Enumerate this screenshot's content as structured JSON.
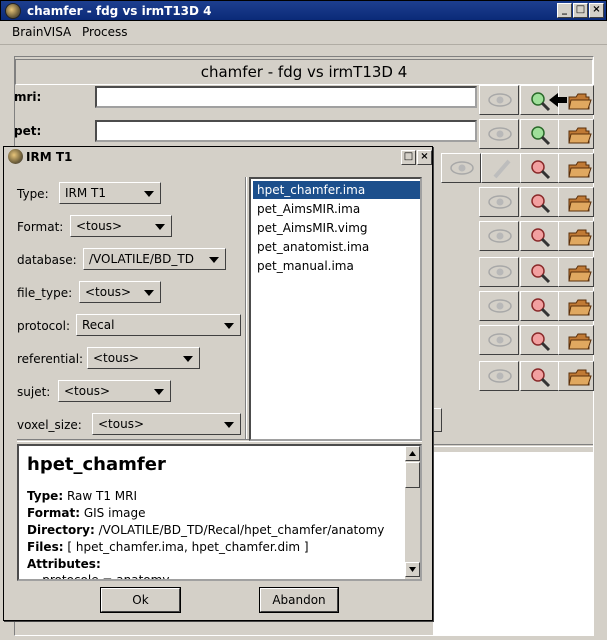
{
  "window": {
    "title": "chamfer - fdg vs irmT13D 4"
  },
  "menu": [
    {
      "label": "BrainVISA",
      "underline": "B"
    },
    {
      "label": "Process",
      "underline": "P"
    }
  ],
  "process": {
    "title": "chamfer - fdg vs irmT13D 4",
    "params": [
      {
        "label": "mri:",
        "value": ""
      },
      {
        "label": "pet:",
        "value": ""
      }
    ]
  },
  "dialog": {
    "title": "IRM T1",
    "fields": [
      {
        "label": "Type:",
        "value": "IRM T1"
      },
      {
        "label": "Format:",
        "value": "<tous>"
      },
      {
        "label": "database:",
        "value": "/VOLATILE/BD_TD"
      },
      {
        "label": "file_type:",
        "value": "<tous>"
      },
      {
        "label": "protocol:",
        "value": "Recal"
      },
      {
        "label": "referential:",
        "value": "<tous>"
      },
      {
        "label": "sujet:",
        "value": "<tous>"
      },
      {
        "label": "voxel_size:",
        "value": "<tous>"
      }
    ],
    "files": [
      "hpet_chamfer.ima",
      "pet_AimsMIR.ima",
      "pet_AimsMIR.vimg",
      "pet_anatomist.ima",
      "pet_manual.ima"
    ],
    "selected_file_index": 0,
    "info": {
      "title": "hpet_chamfer",
      "type_label": "Type:",
      "type_value": "Raw T1 MRI",
      "format_label": "Format:",
      "format_value": "GIS image",
      "directory_label": "Directory:",
      "directory_value": "/VOLATILE/BD_TD/Recal/hpet_chamfer/anatomy",
      "files_label": "Files:",
      "files_value": "[ hpet_chamfer.ima, hpet_chamfer.dim ]",
      "attributes_label": "Attributes:",
      "attr_partial": "    protocole = anatomy"
    },
    "ok_label": "Ok",
    "cancel_label": "Abandon"
  },
  "colors": {
    "titlebar": "#0b2a78",
    "selection": "#1c4f8c",
    "window_bg": "#d4d0c8"
  },
  "icons": [
    "eye-icon",
    "magnifier-green-icon",
    "magnifier-red-icon",
    "folder-icon",
    "pen-icon",
    "arrow-icon"
  ]
}
